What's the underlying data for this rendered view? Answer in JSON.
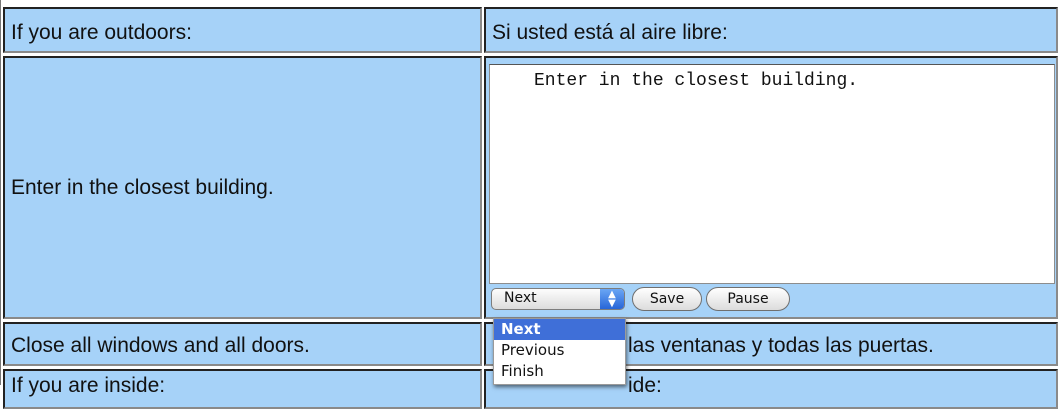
{
  "table": {
    "row1_en": "If you are outdoors:",
    "row1_es": "Si usted está al aire libre:",
    "row2_en": "Enter in the closest building.",
    "row3_en": "Close all windows and all doors.",
    "row3_es_visible": "las ventanas y todas las puertas.",
    "row4_en_visible": "If you are inside:",
    "row4_es_visible": "ide:"
  },
  "editor": {
    "text": "Enter in the closest building."
  },
  "controls": {
    "select_value": "Next",
    "save_label": "Save",
    "pause_label": "Pause",
    "dropdown_icon": "updown-chevrons-icon"
  },
  "dropdown_menu": {
    "options": [
      "Next",
      "Previous",
      "Finish"
    ],
    "selected": "Next"
  },
  "colors": {
    "cell_bg": "#a6d2f8",
    "menu_highlight": "#3f6fd8"
  }
}
